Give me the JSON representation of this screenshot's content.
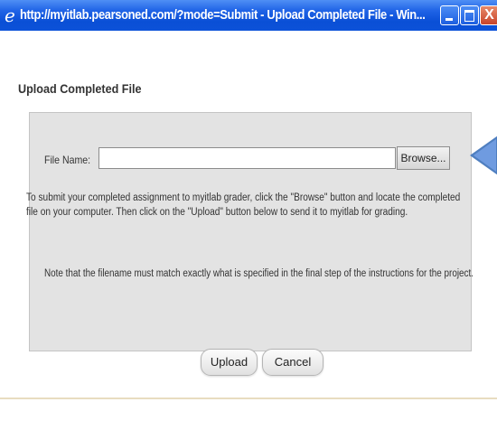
{
  "window": {
    "title": "http://myitlab.pearsoned.com/?mode=Submit - Upload Completed File - Win...",
    "close_glyph": "X",
    "icons": {
      "app": "ie-icon",
      "minimize": "minimize-icon",
      "maximize": "maximize-icon",
      "close": "close-icon"
    }
  },
  "page": {
    "title": "Upload Completed File"
  },
  "form": {
    "file_label": "File Name:",
    "file_value": "",
    "browse_label": "Browse...",
    "instructions": "To submit your completed assignment to myitlab grader, click the \"Browse\" button and locate the completed file on your computer. Then click on the \"Upload\" button below to send it to myitlab for grading.",
    "note": "Note that the filename must match exactly what is specified in the final step of the instructions for the project."
  },
  "actions": {
    "upload_label": "Upload",
    "cancel_label": "Cancel"
  },
  "colors": {
    "titlebar": "#0a4fd6",
    "panel": "#e3e3e3",
    "callout": "#4f7fc0"
  }
}
